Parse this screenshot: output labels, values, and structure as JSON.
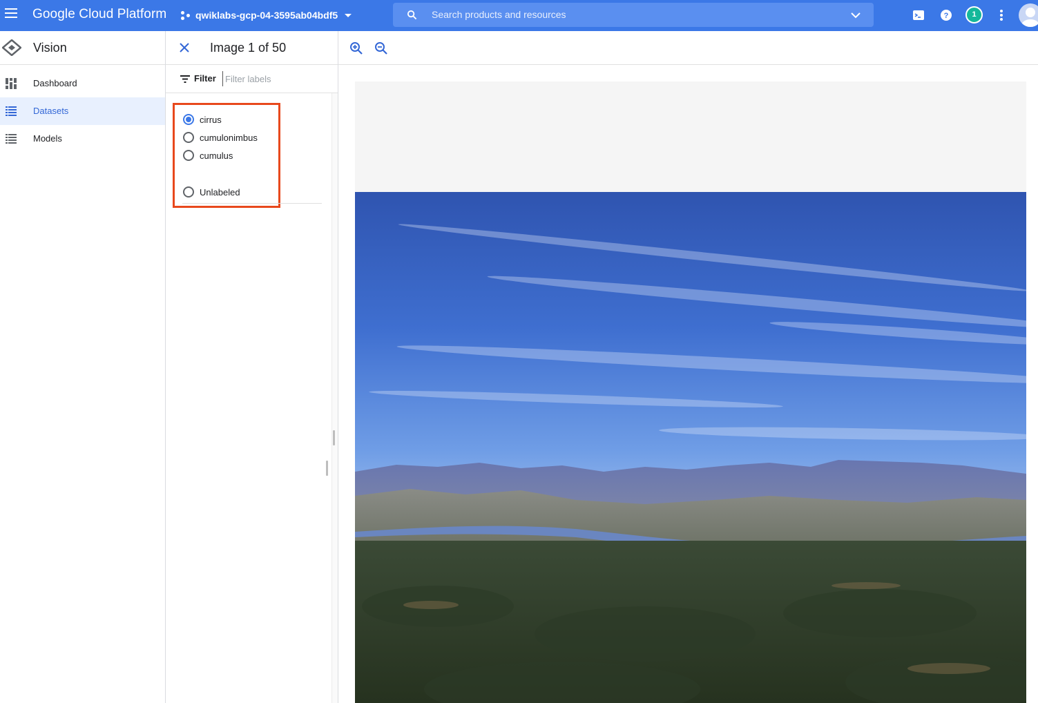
{
  "topbar": {
    "brand": "Google Cloud Platform",
    "project_name": "qwiklabs-gcp-04-3595ab04bdf5",
    "search_placeholder": "Search products and resources",
    "notification_count": "1",
    "icons": [
      "menu-icon",
      "project-icon",
      "search-icon",
      "chevron-down-icon",
      "cloud-shell-icon",
      "help-icon",
      "more-vert-icon",
      "avatar"
    ],
    "accent_color": "#3b78e7"
  },
  "sidebar": {
    "product": "Vision",
    "items": [
      {
        "label": "Dashboard",
        "icon": "dashboard-icon",
        "active": false
      },
      {
        "label": "Datasets",
        "icon": "list-icon",
        "active": true
      },
      {
        "label": "Models",
        "icon": "list-icon",
        "active": false
      }
    ]
  },
  "panel": {
    "title": "Image 1 of 50",
    "filter_label": "Filter",
    "filter_placeholder": "Filter labels",
    "labels": [
      {
        "label": "cirrus",
        "checked": true
      },
      {
        "label": "cumulonimbus",
        "checked": false
      },
      {
        "label": "cumulus",
        "checked": false
      }
    ],
    "unlabeled": {
      "label": "Unlabeled",
      "checked": false
    },
    "highlight_color": "#e8481c"
  },
  "viewer": {
    "controls": [
      "zoom-in-icon",
      "zoom-out-icon"
    ],
    "image": "landscape photo of cirrus clouds over mountains and a lake"
  }
}
